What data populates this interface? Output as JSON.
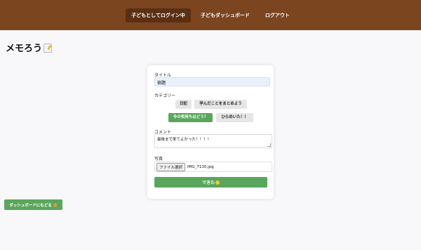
{
  "nav": {
    "items": [
      {
        "label": "子どもとしてログイン中",
        "active": true
      },
      {
        "label": "子どもダッシュボード",
        "active": false
      },
      {
        "label": "ログアウト",
        "active": false
      }
    ]
  },
  "page": {
    "title": "メモろう"
  },
  "form": {
    "title_label": "タイトル",
    "title_value": "宿題",
    "category_label": "カテゴリー",
    "categories": [
      {
        "label": "日記",
        "selected": false
      },
      {
        "label": "学んだことをまとめよう",
        "selected": false
      },
      {
        "label": "今の気持ちはどう？",
        "selected": true
      },
      {
        "label": "ひらめいた！！",
        "selected": false
      }
    ],
    "comment_label": "コメント",
    "comment_value": "最後まで来てよかった！！！！",
    "photo_label": "写真",
    "file_button_label": "ファイル選択",
    "file_name": "IMG_7130.jpg",
    "submit_label": "できた"
  },
  "back_button_label": "ダッシュボードにもどる",
  "colors": {
    "nav_background": "#7b4520",
    "nav_active": "#5a2f13",
    "accent_green": "#5aa65c",
    "title_input_background": "#e8f0fe"
  },
  "icons": {
    "title_icon": "memo-icon",
    "submit_icon": "smile-icon",
    "back_icon": "house-icon"
  }
}
